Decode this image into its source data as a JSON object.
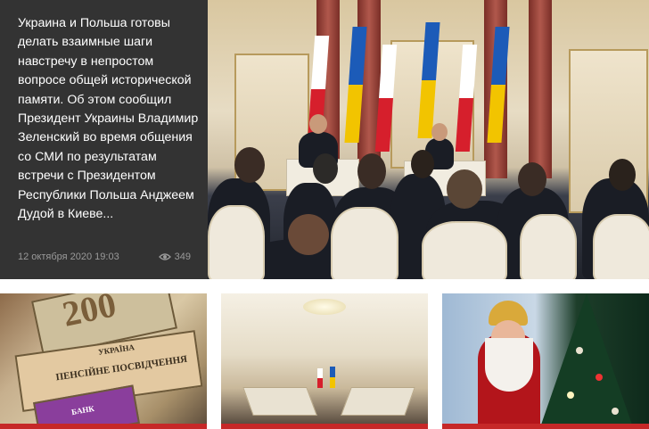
{
  "featured": {
    "summary": "Украина и Польша готовы делать взаимные шаги навстречу в непростом вопросе общей исторической памяти. Об этом сообщил Президент Украины Владимир Зеленский во время общения со СМИ по результатам встречи с Президентом Республики Польша Анджеем Дудой в Киеве...",
    "date": "12 октября 2020 19:03",
    "views": "349",
    "views_icon": "eye-icon"
  },
  "cards": [
    {
      "note_number": "200",
      "note_line1": "УКРАЇНА",
      "note_line2": "ПЕНСІЙНЕ ПОСВІДЧЕННЯ",
      "note_line3": "БАНК"
    },
    {},
    {}
  ],
  "colors": {
    "featured_bg": "#333333",
    "meta_text": "#9a9a9a",
    "card_accent": "#c62828"
  }
}
